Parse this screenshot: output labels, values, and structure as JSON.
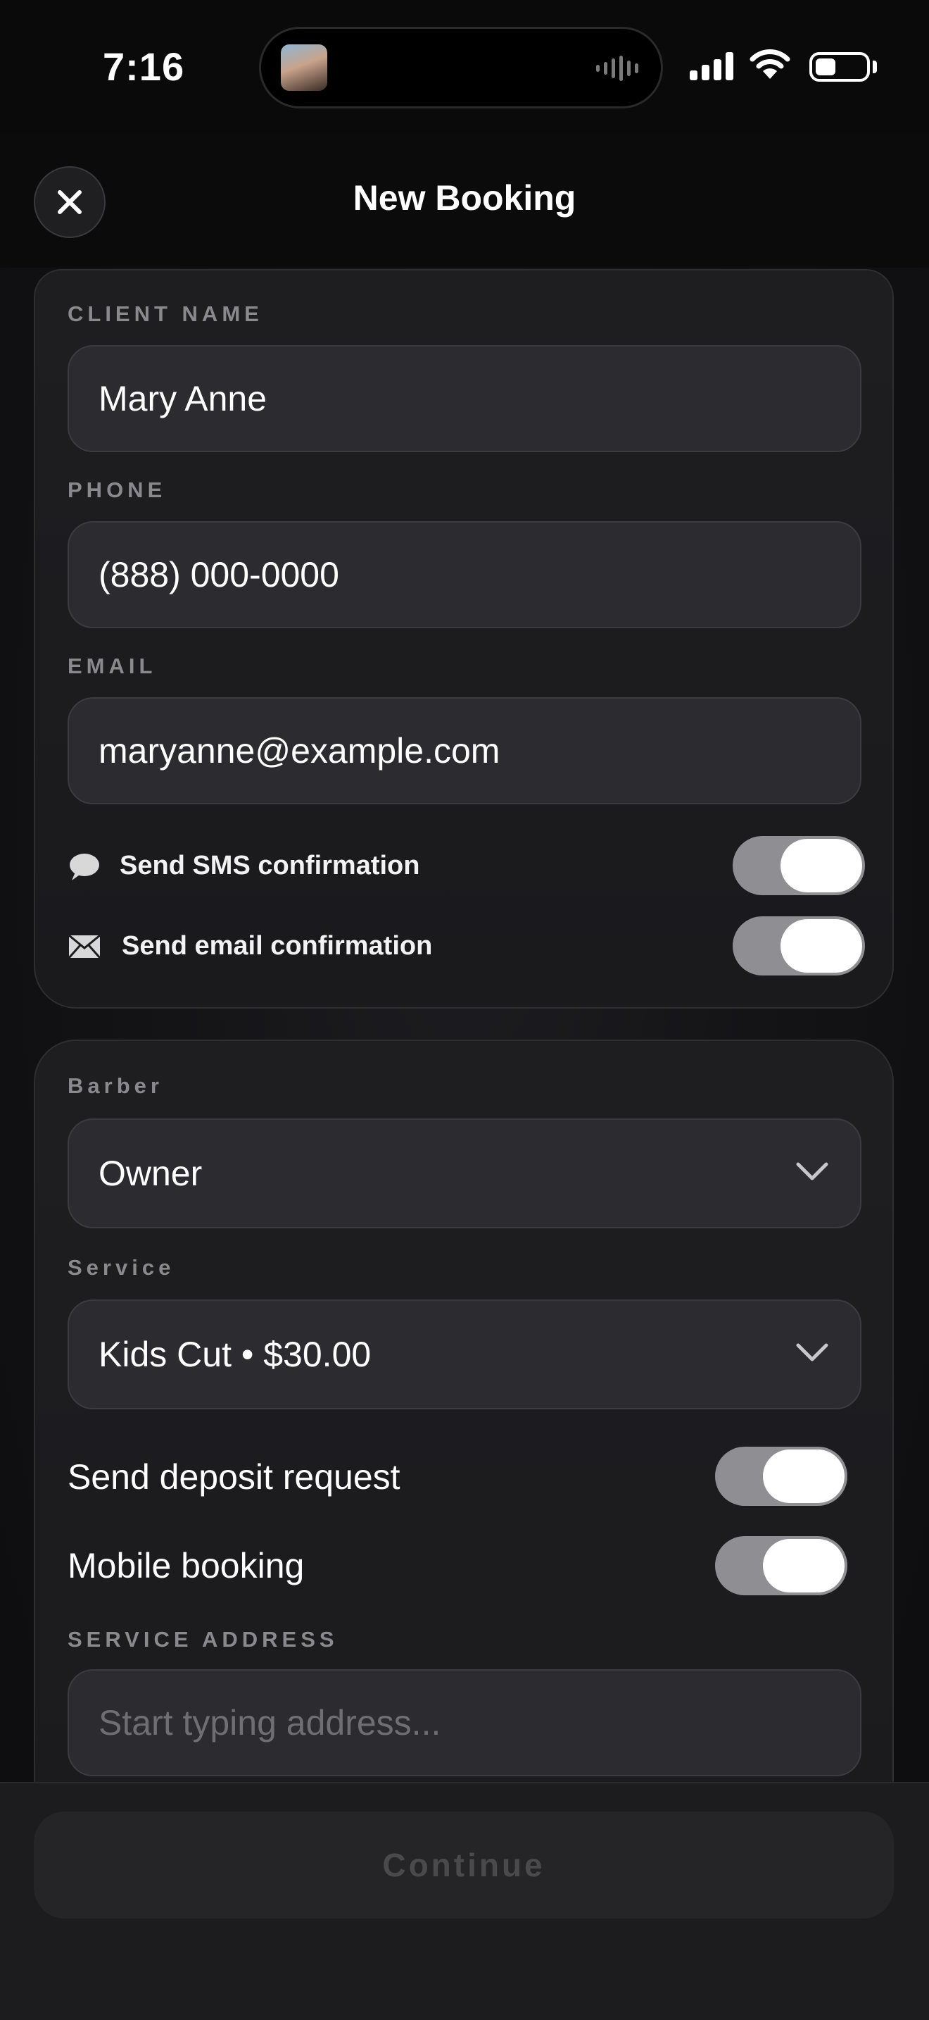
{
  "status_bar": {
    "time": "7:16"
  },
  "header": {
    "title": "New Booking",
    "close_icon": "close-icon"
  },
  "client": {
    "name_label": "CLIENT NAME",
    "name_value": "Mary Anne",
    "phone_label": "PHONE",
    "phone_value": "(888) 000-0000",
    "email_label": "EMAIL",
    "email_value": "maryanne@example.com",
    "sms_label": "Send SMS confirmation",
    "sms_on": true,
    "email_confirm_label": "Send email confirmation",
    "email_confirm_on": true
  },
  "booking": {
    "barber_label": "Barber",
    "barber_value": "Owner",
    "service_label": "Service",
    "service_value": "Kids Cut • $30.00",
    "deposit_label": "Send deposit request",
    "deposit_on": true,
    "mobile_label": "Mobile booking",
    "mobile_on": true,
    "address_label": "SERVICE ADDRESS",
    "address_placeholder": "Start typing address..."
  },
  "footer": {
    "continue_label": "Continue"
  },
  "colors": {
    "background": "#141417",
    "card": "#1e1e21",
    "field": "#2c2c30",
    "toggle_track": "#8e8e93",
    "label": "#8a8a8e"
  }
}
